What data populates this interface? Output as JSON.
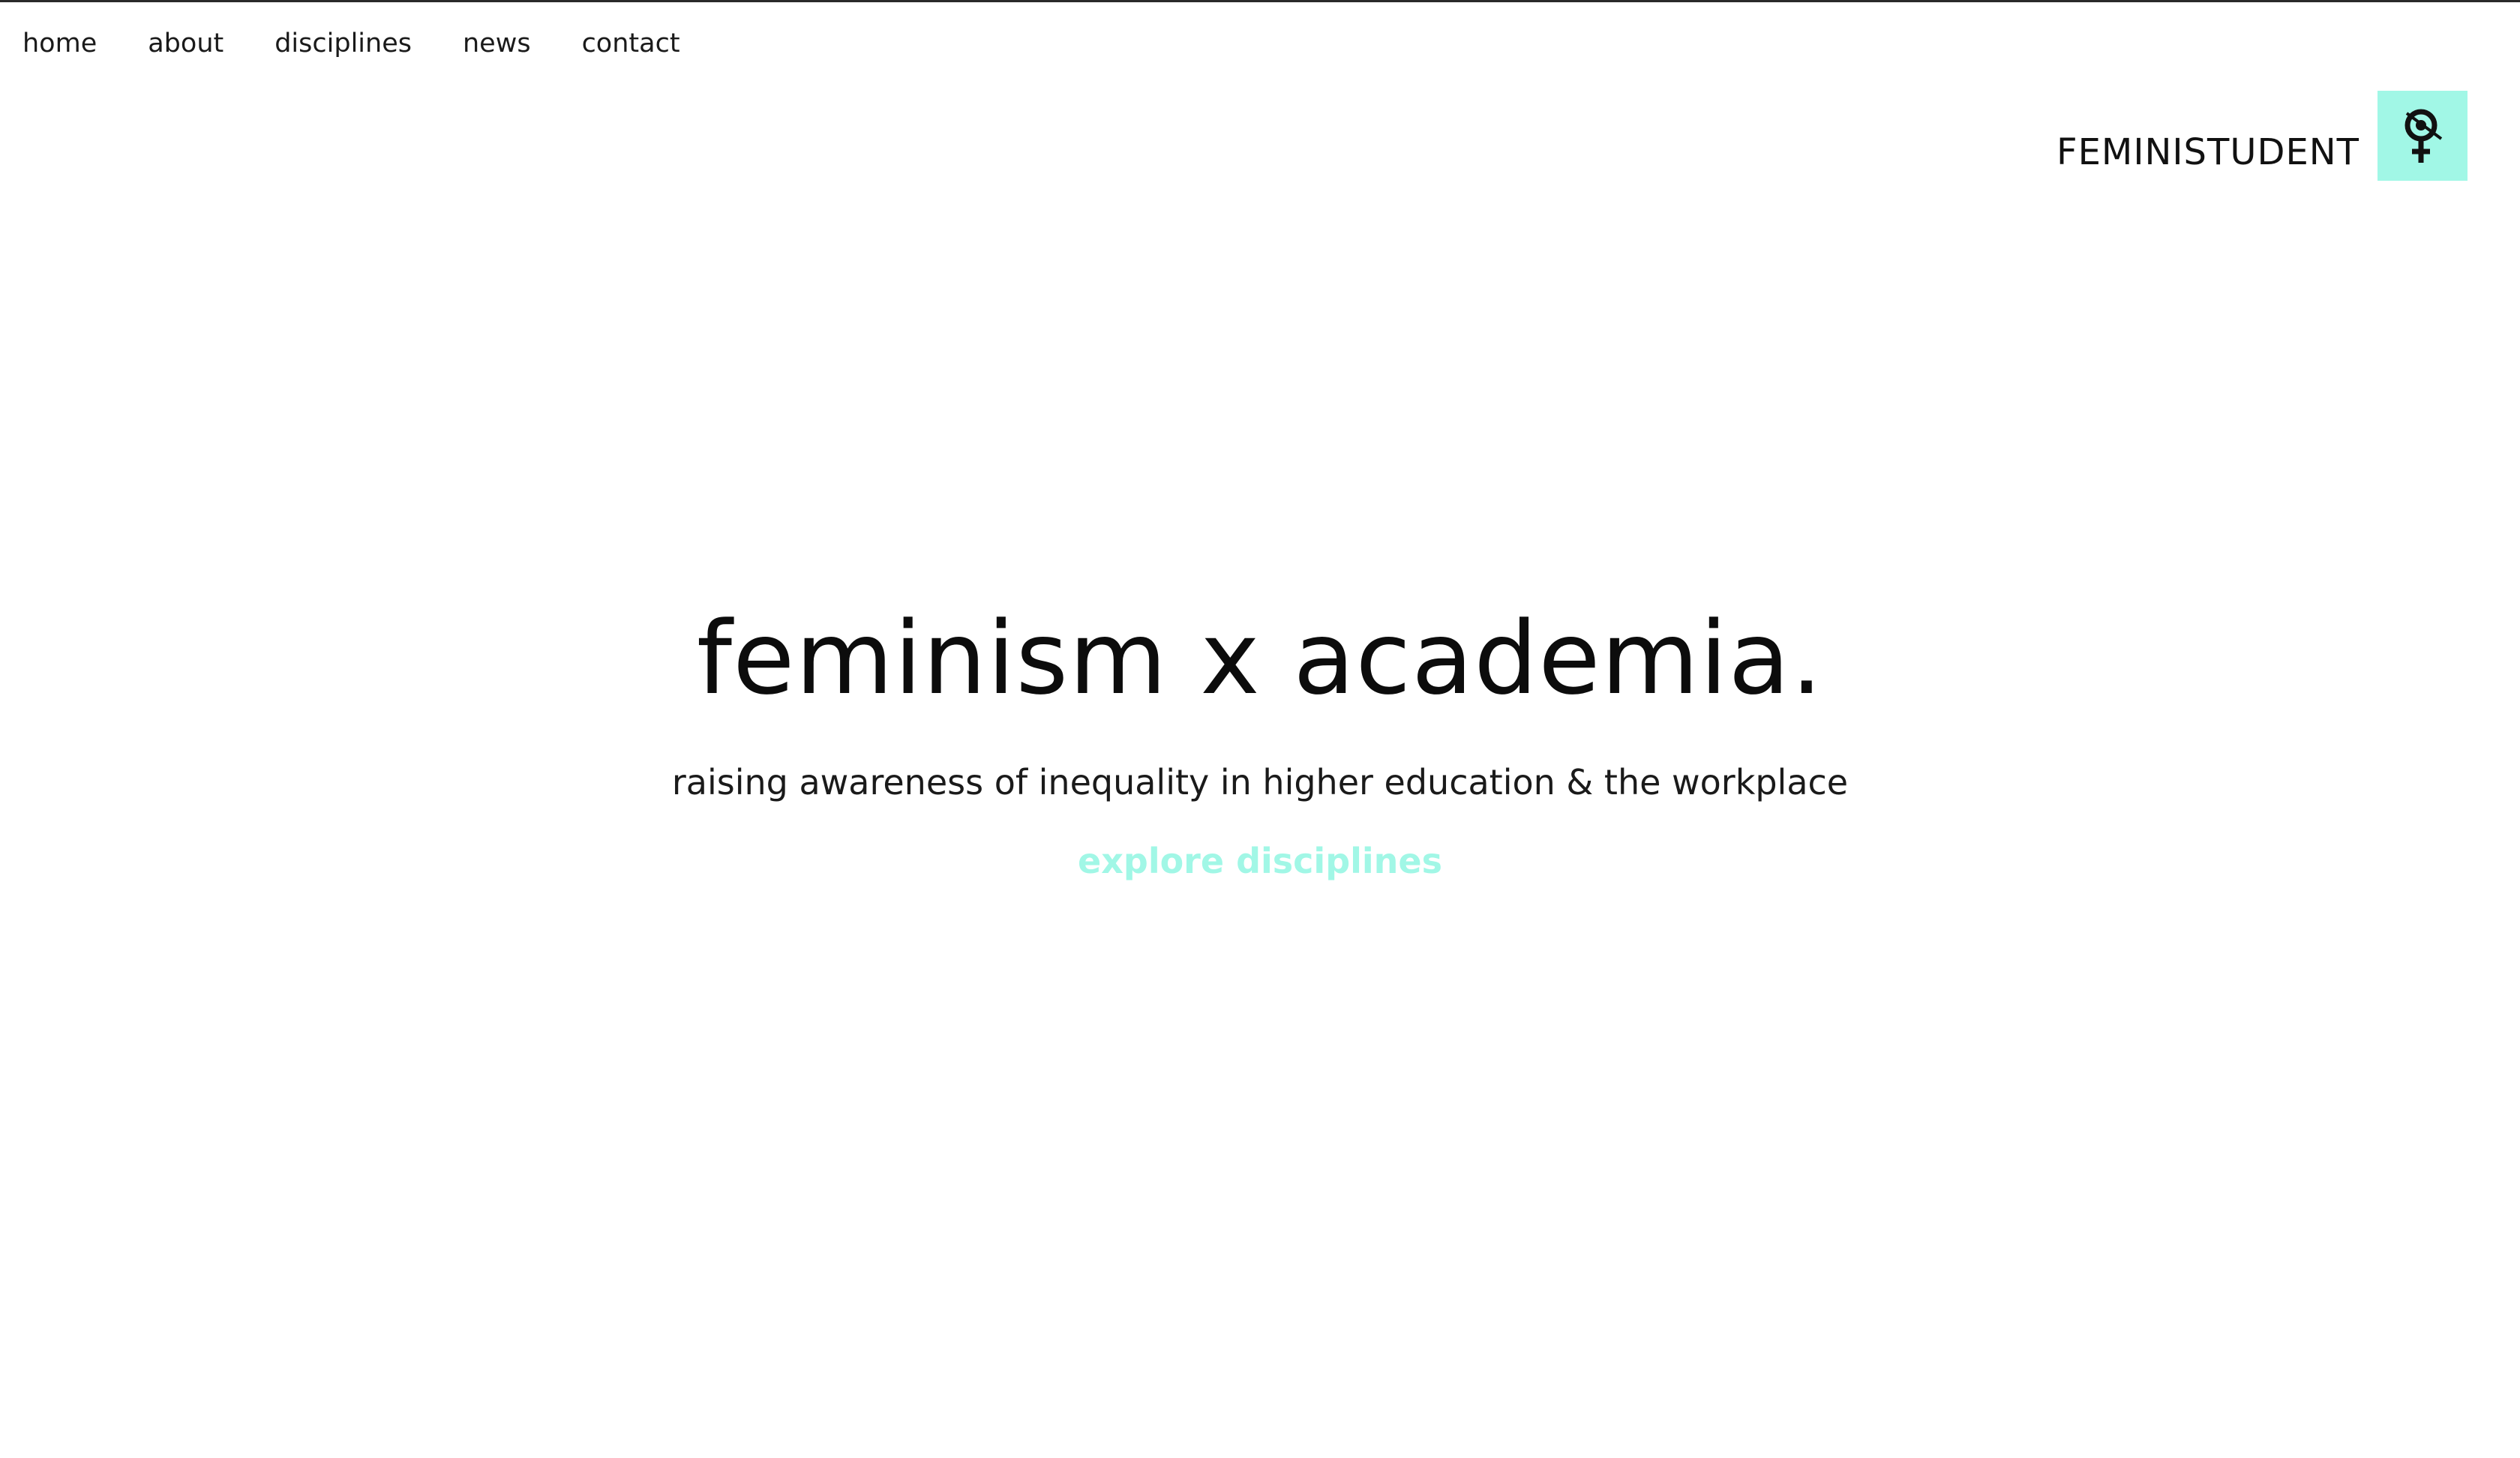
{
  "nav": {
    "items": [
      {
        "label": "home"
      },
      {
        "label": "about"
      },
      {
        "label": "disciplines"
      },
      {
        "label": "news"
      },
      {
        "label": "contact"
      }
    ]
  },
  "brand": {
    "name": "FEMINISTUDENT",
    "logo_icon": "venus-symbol-icon"
  },
  "hero": {
    "title": "feminism x academia.",
    "subtitle": "raising awareness of inequality in higher education & the workplace",
    "cta_label": "explore disciplines"
  },
  "colors": {
    "accent": "#a1f7e6",
    "text": "#111111",
    "background": "#ffffff"
  }
}
